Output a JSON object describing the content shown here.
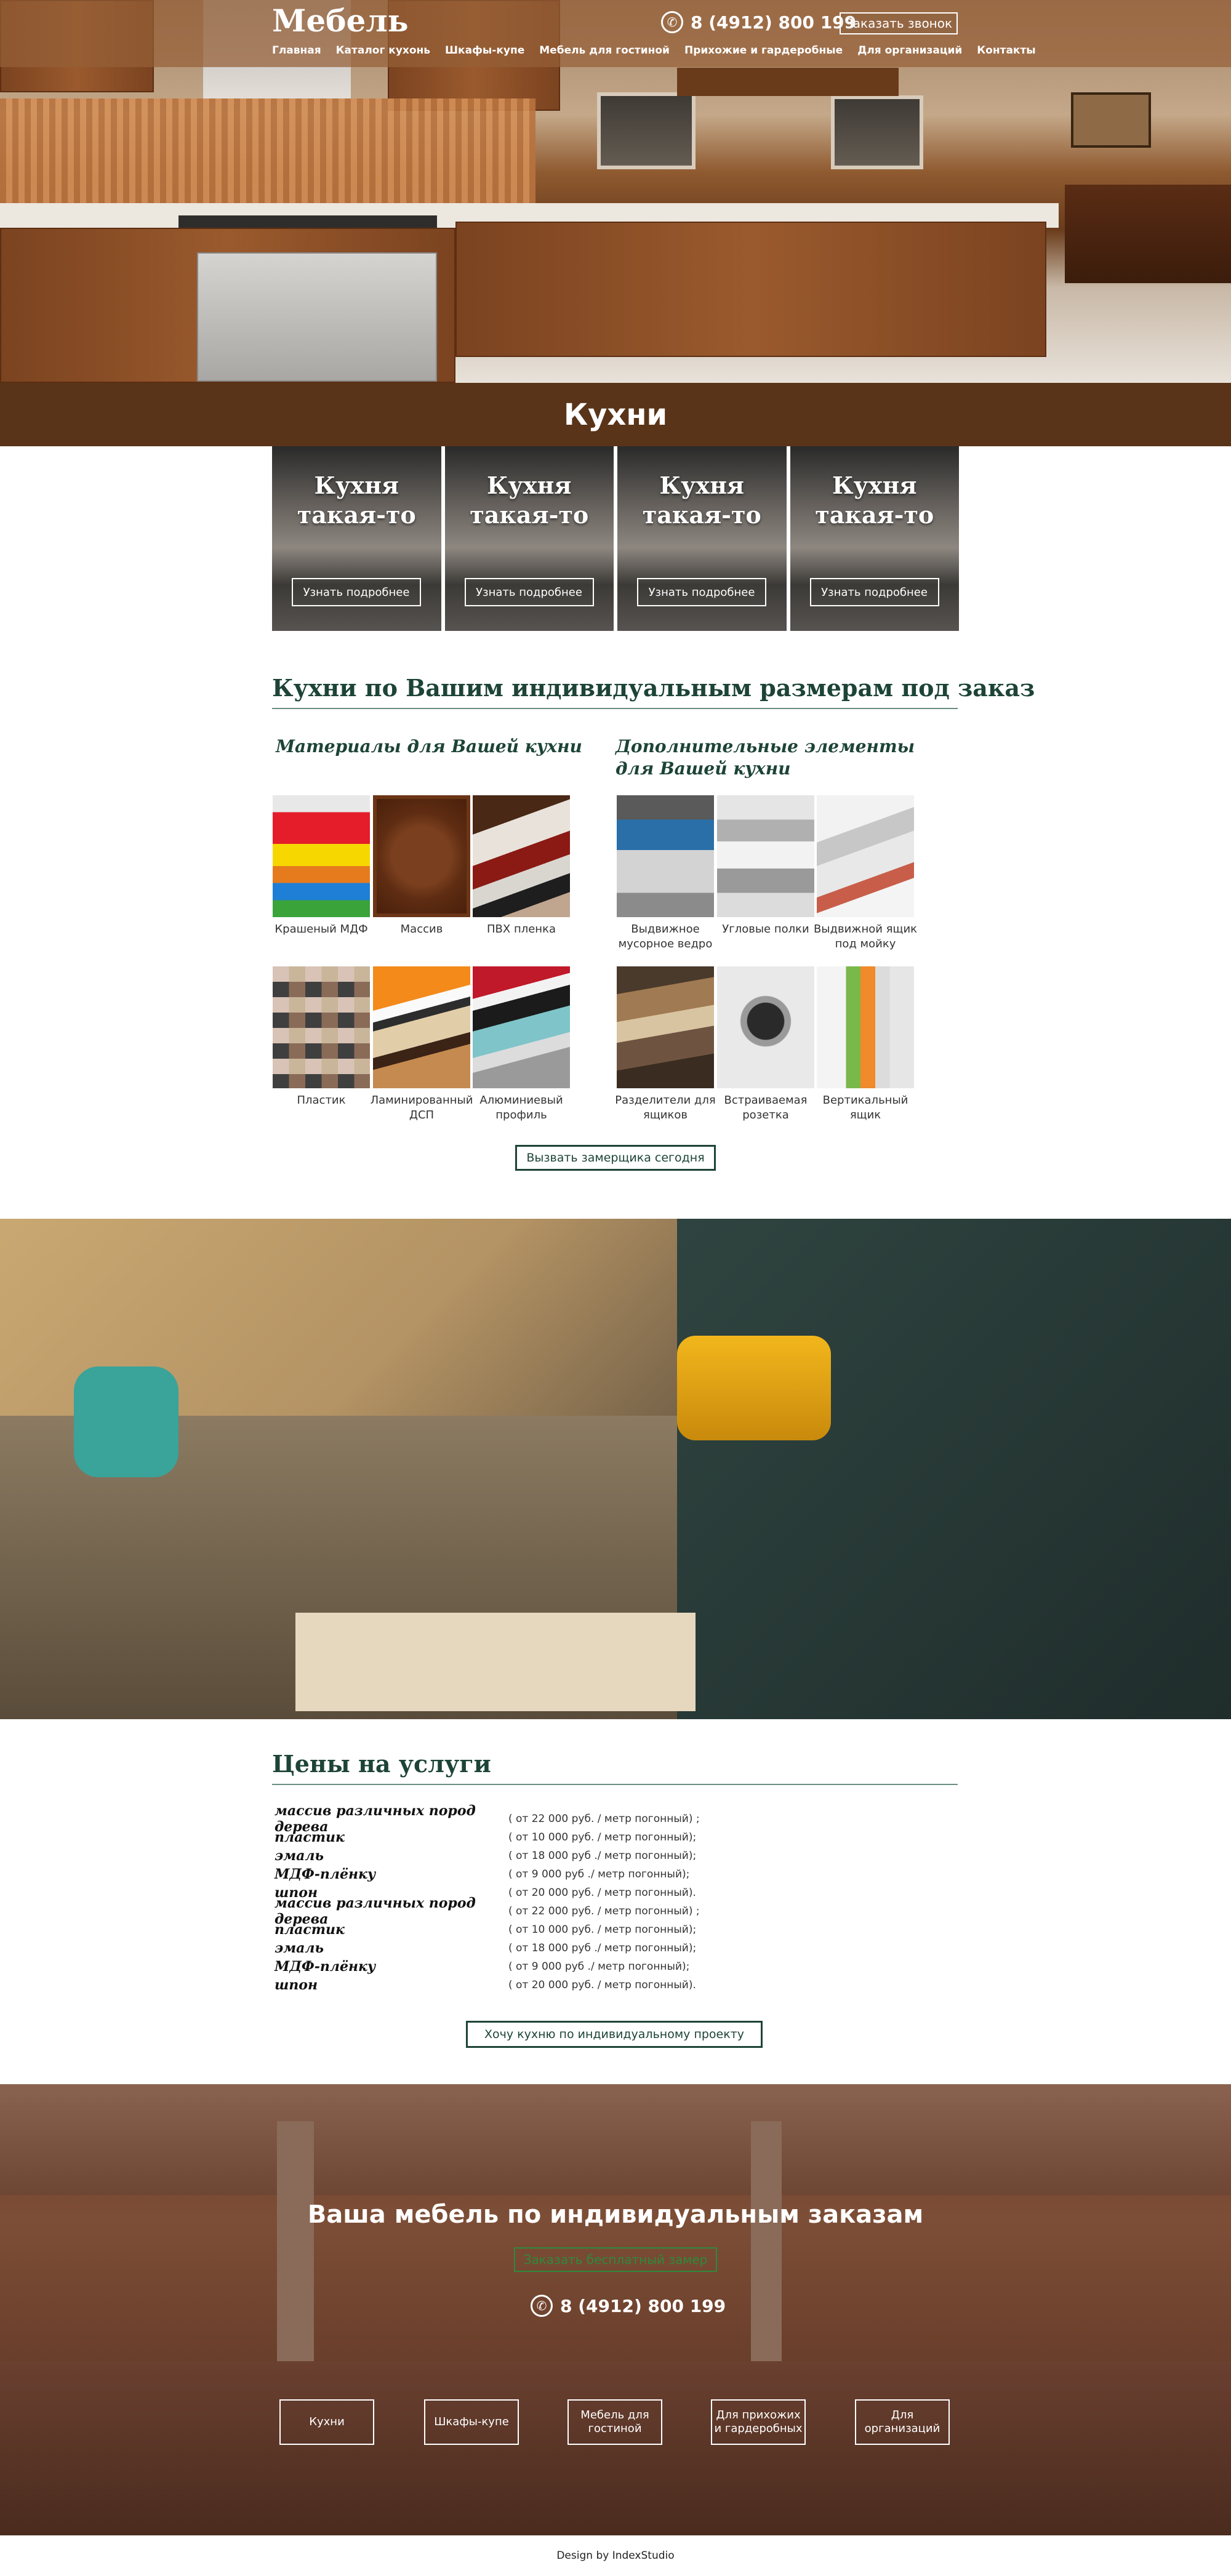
{
  "header": {
    "logo": "Мебель",
    "phone": "8 (4912) 800 199",
    "call_button": "Заказать звонок",
    "nav": [
      "Главная",
      "Каталог кухонь",
      "Шкафы-купе",
      "Мебель для гостиной",
      "Прихожие и гардеробные",
      "Для организаций",
      "Контакты"
    ]
  },
  "hero_title": "Кухни",
  "kitchen_cards": [
    {
      "title_line1": "Кухня",
      "title_line2": "такая-то",
      "button": "Узнать подробнее"
    },
    {
      "title_line1": "Кухня",
      "title_line2": "такая-то",
      "button": "Узнать подробнее"
    },
    {
      "title_line1": "Кухня",
      "title_line2": "такая-то",
      "button": "Узнать подробнее"
    },
    {
      "title_line1": "Кухня",
      "title_line2": "такая-то",
      "button": "Узнать подробнее"
    }
  ],
  "custom_section": {
    "title": "Кухни по Вашим индивидуальным размерам под заказ",
    "materials_title": "Материалы для Вашей кухни",
    "extras_title_line1": "Дополнительные элементы",
    "extras_title_line2": "для Вашей кухни",
    "materials": [
      "Крашеный МДФ",
      "Массив",
      "ПВХ пленка",
      "Пластик",
      "Ламинированный ДСП",
      "Алюминиевый профиль"
    ],
    "extras": [
      "Выдвижное мусорное ведро",
      "Угловые полки",
      "Выдвижной ящик под мойку",
      "Разделители для ящиков",
      "Встраиваемая розетка",
      "Вертикальный ящик"
    ],
    "cta": "Вызвать замерщика сегодня"
  },
  "prices": {
    "title": "Цены на услуги",
    "rows": [
      {
        "name": "массив различных пород дерева",
        "price": "( от 22 000 руб. / метр погонный) ;"
      },
      {
        "name": "пластик",
        "price": "( от 10 000 руб. / метр погонный);"
      },
      {
        "name": "эмаль",
        "price": "( от 18 000 руб ./ метр погонный);"
      },
      {
        "name": "МДФ-плёнку",
        "price": "( от 9 000 руб ./ метр погонный);"
      },
      {
        "name": "шпон",
        "price": "( от 20 000 руб. / метр погонный)."
      },
      {
        "name": "массив различных пород дерева",
        "price": "( от 22 000 руб. / метр погонный) ;"
      },
      {
        "name": "пластик",
        "price": "( от 10 000 руб. / метр погонный);"
      },
      {
        "name": "эмаль",
        "price": "( от 18 000 руб ./ метр погонный);"
      },
      {
        "name": "МДФ-плёнку",
        "price": "( от 9 000 руб ./ метр погонный);"
      },
      {
        "name": "шпон",
        "price": "( от 20 000 руб. / метр погонный)."
      }
    ],
    "cta": "Хочу кухню по индивидуальному проекту"
  },
  "footer_block": {
    "title": "Ваша мебель по индивидуальным заказам",
    "button": "Заказать бесплатный замер",
    "phone": "8 (4912) 800 199",
    "categories": [
      "Кухни",
      "Шкафы-купе",
      "Мебель для гостиной",
      "Для прихожих и гардеробных",
      "Для организаций"
    ]
  },
  "credit": "Design by IndexStudio",
  "colors": {
    "accent": "#1d4436",
    "brown": "#5a3418",
    "green_button": "#2e8a3c"
  }
}
